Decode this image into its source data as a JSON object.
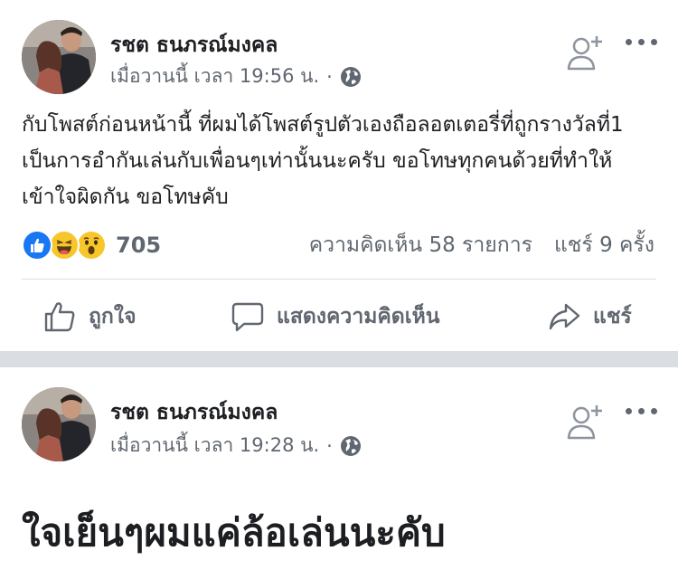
{
  "posts": [
    {
      "author": "รชต ธนภรณ์มงคล",
      "time": "เมื่อวานนี้ เวลา 19:56 น.",
      "separator_dot": "·",
      "text": "กับโพสต์ก่อนหน้านี้ ที่ผมได้โพสต์รูปตัวเองถือลอตเตอรี่ที่ถูกรางวัลที่1 เป็นการอำกันเล่นกับเพื่อนๆเท่านั้นนะครับ ขอโทษทุกคนด้วยที่ทำให้เข้าใจผิดกัน  ขอโทษคับ",
      "reaction_count": "705",
      "comments": "ความคิดเห็น 58 รายการ",
      "shares": "แชร์ 9 ครั้ง",
      "actions": {
        "like": "ถูกใจ",
        "comment": "แสดงความคิดเห็น",
        "share": "แชร์"
      }
    },
    {
      "author": "รชต ธนภรณ์มงคล",
      "time": "เมื่อวานนี้ เวลา 19:28 น.",
      "separator_dot": "·",
      "text": "ใจเย็นๆผมแค่ล้อเล่นนะคับ"
    }
  ],
  "icons": {
    "avatar": "profile-photo",
    "privacy": "globe-icon",
    "add_friend": "add-friend-icon",
    "more": "more-options-icon",
    "reactions": [
      "like-reaction-icon",
      "haha-reaction-icon",
      "wow-reaction-icon"
    ],
    "like": "thumbs-up-icon",
    "comment": "comment-bubble-icon",
    "share": "share-arrow-icon"
  },
  "colors": {
    "text": "#1c1e21",
    "secondary": "#606770",
    "like_blue": "#1877f2",
    "reaction_yellow": "#f7c62b",
    "separator": "#dadde1"
  }
}
